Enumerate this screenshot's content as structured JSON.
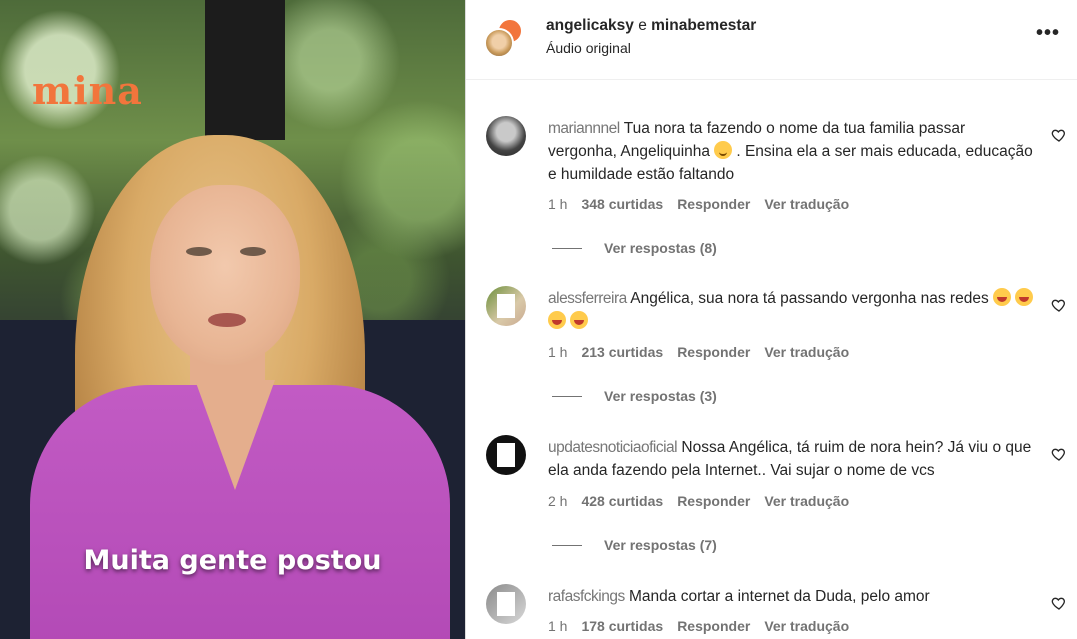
{
  "video": {
    "logo": "mina",
    "caption": "Muita gente postou"
  },
  "header": {
    "user": "angelicaksy",
    "connector": " e ",
    "collab": "minabemestar",
    "subtitle": "Áudio original",
    "more_label": "•••"
  },
  "comments": [
    {
      "username": "mariannnel",
      "text": "Tua nora ta fazendo o nome da tua familia passar vergonha, Angeliquinha",
      "text_after": ". Ensina ela a ser mais educada, educação e humildade estão faltando",
      "emoji": "blush",
      "time": "1 h",
      "likes": "348 curtidas",
      "reply": "Responder",
      "translate": "Ver tradução",
      "view_replies": "Ver respostas (8)"
    },
    {
      "username": "alessferreira",
      "text": "Angélica, sua nora tá passando vergonha nas redes",
      "emoji": "laugh",
      "time": "1 h",
      "likes": "213 curtidas",
      "reply": "Responder",
      "translate": "Ver tradução",
      "view_replies": "Ver respostas (3)"
    },
    {
      "username": "updatesnoticiaoficial",
      "text": "Nossa Angélica, tá ruim de nora hein? Já viu o que ela anda fazendo pela Internet.. Vai sujar o nome de vcs",
      "time": "2 h",
      "likes": "428 curtidas",
      "reply": "Responder",
      "translate": "Ver tradução",
      "view_replies": "Ver respostas (7)"
    },
    {
      "username": "rafasfckings",
      "text": "Manda cortar a internet da Duda, pelo amor",
      "time": "1 h",
      "likes": "178 curtidas",
      "reply": "Responder",
      "translate": "Ver tradução"
    }
  ]
}
